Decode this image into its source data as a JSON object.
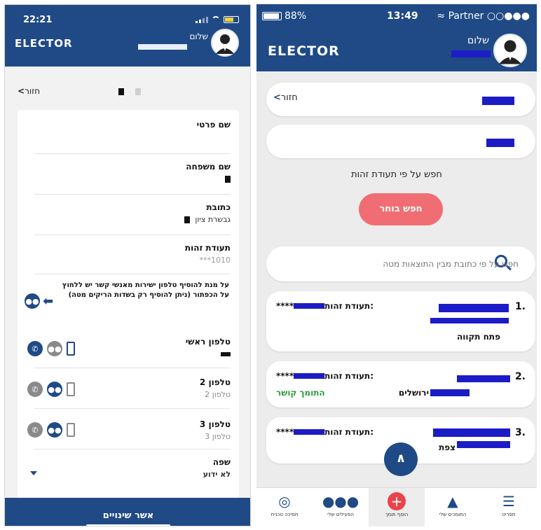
{
  "left": {
    "status": {
      "time": "22:21"
    },
    "header": {
      "logo": "ELECTOR",
      "greeting": "שלום"
    },
    "back_label": "חזור",
    "fields": [
      {
        "label": "שם פרטי",
        "value": ""
      },
      {
        "label": "שם משפחה",
        "value": ""
      },
      {
        "label": "כתובת",
        "value": "גבשרת ציון"
      },
      {
        "label": "תעודת זהות",
        "value": "***1010"
      }
    ],
    "note": "על מנת להוסיף טלפון ישירות מאנשי קשר יש ללחוץ על הכפתור (ניתן להוסיף רק בשדות הריקים מטה)",
    "phones": [
      {
        "label": "טלפון ראשי",
        "value": ""
      },
      {
        "label": "טלפון 2",
        "value": "טלפון 2"
      },
      {
        "label": "טלפון 3",
        "value": "טלפון 3"
      }
    ],
    "language": {
      "label": "שפה",
      "value": "לא ידוע"
    },
    "confirm_label": "אשר שינויים"
  },
  "right": {
    "status": {
      "battery": "88%",
      "time": "13:49",
      "carrier": "Partner"
    },
    "header": {
      "logo": "ELECTOR",
      "greeting": "שלום"
    },
    "back_label": "חזור",
    "search_label": "חפש על פי תעודת זהות",
    "search_button": "חפש בוחר",
    "filter_placeholder": "חפש על פי כתובת מבין התוצאות מטה",
    "results": [
      {
        "num": "1.",
        "id_label": "תעודת זהות:",
        "id_suffix": "****",
        "city": "פתח תקווה",
        "status": ""
      },
      {
        "num": "2.",
        "id_label": "תעודת זהות:",
        "id_suffix": "****",
        "city": "ירושלים",
        "status": "התומך קושר"
      },
      {
        "num": "3.",
        "id_label": "תעודת זהות:",
        "id_suffix": "****",
        "city": "צפת",
        "status": ""
      }
    ],
    "tabs": [
      {
        "label": "תמיכה טכנית",
        "icon": "lifebuoy-icon"
      },
      {
        "label": "הפעילים שלי",
        "icon": "people-icon"
      },
      {
        "label": "הוסף תומך",
        "icon": "plus-icon"
      },
      {
        "label": "התומכים שלי",
        "icon": "thumbs-up-icon"
      },
      {
        "label": "תפריט",
        "icon": "menu-icon"
      }
    ]
  },
  "colors": {
    "primary": "#1f4a86",
    "accent": "#f06e73",
    "success": "#2a9a3a",
    "redact": "#1c1cc6"
  }
}
